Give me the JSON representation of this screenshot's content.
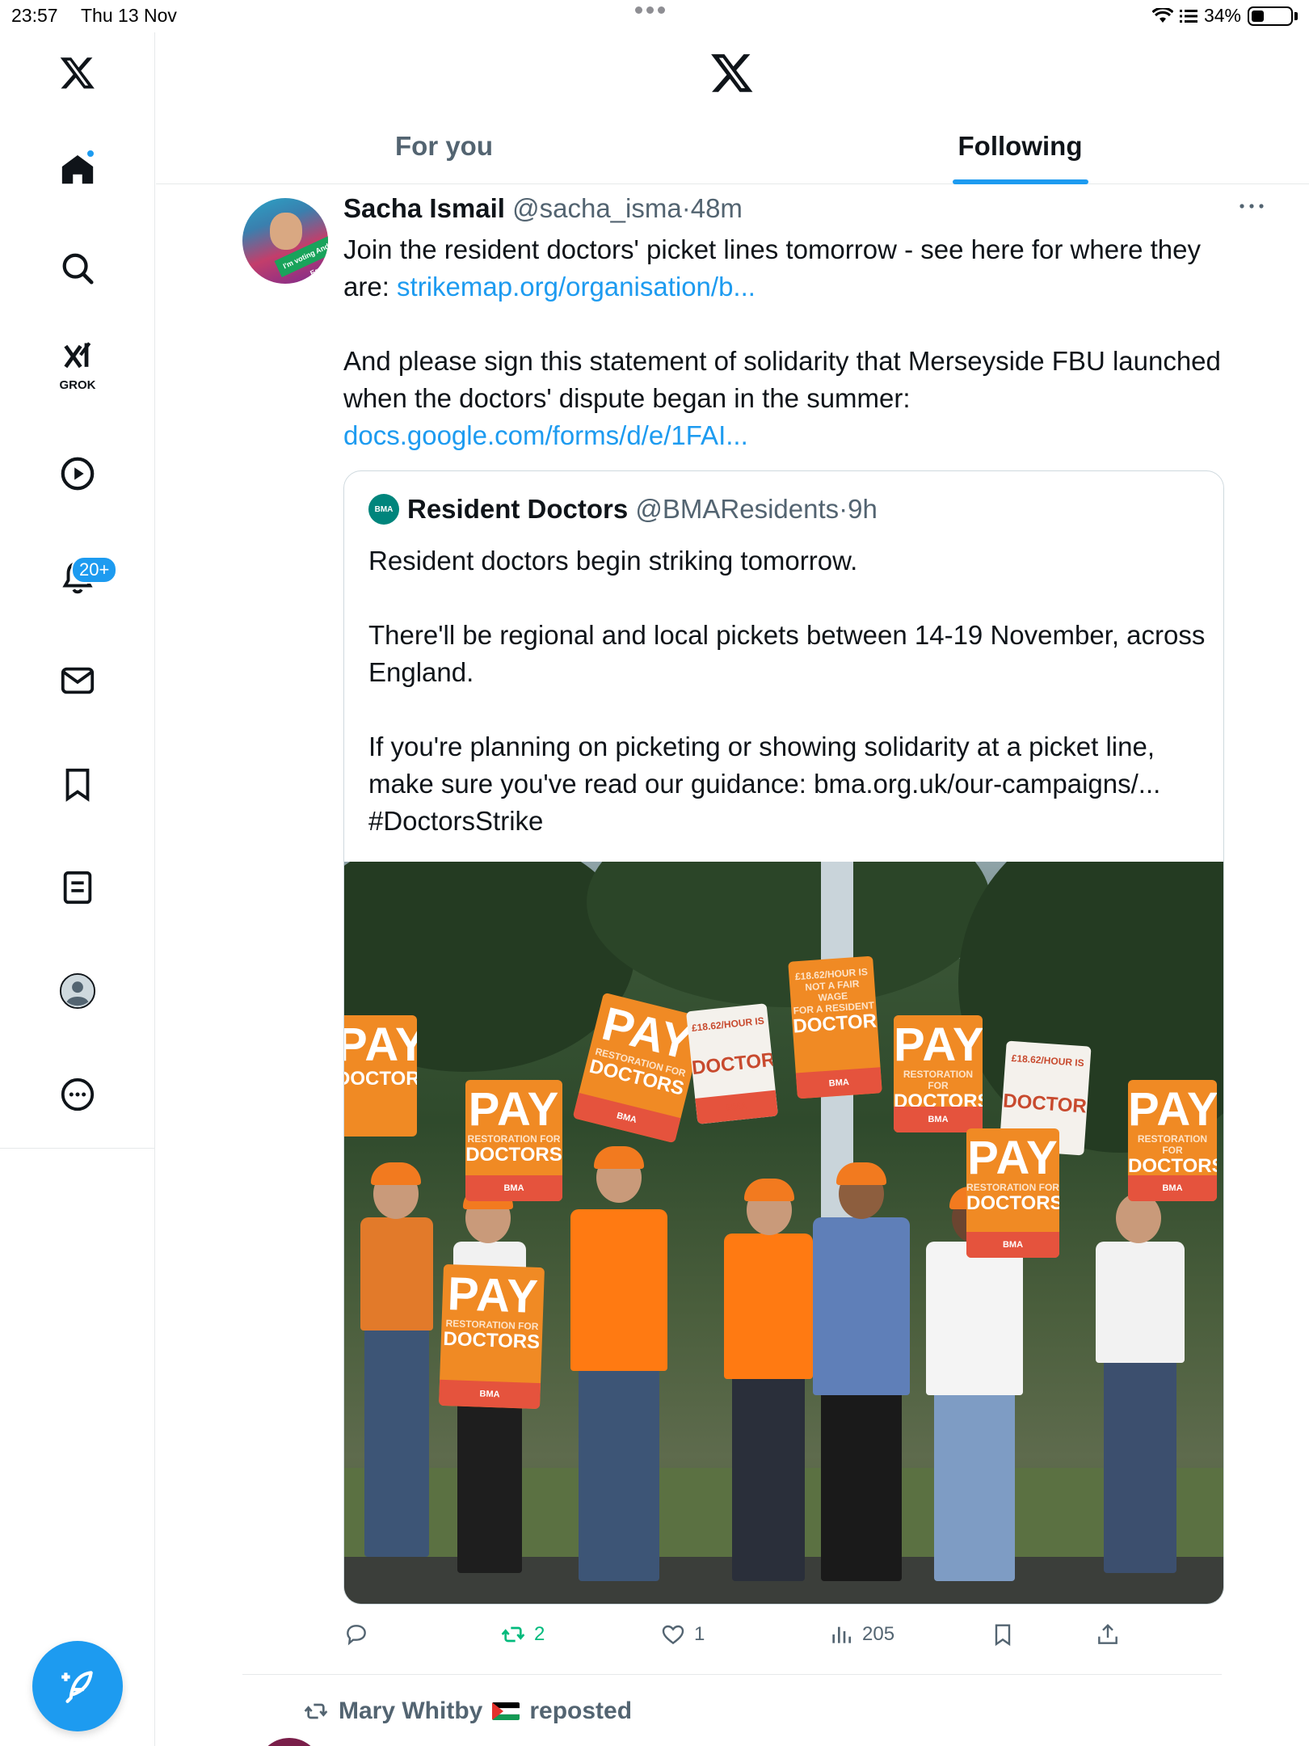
{
  "status_bar": {
    "time": "23:57",
    "date": "Thu 13 Nov",
    "battery": "34%"
  },
  "sidebar": {
    "notifications_badge": "20+",
    "grok_label": "GROK",
    "icons": [
      "x-logo-icon",
      "home-icon",
      "search-icon",
      "grok-icon",
      "video-icon",
      "bell-icon",
      "mail-icon",
      "bookmark-icon",
      "lists-icon",
      "profile-icon",
      "more-circle-icon"
    ]
  },
  "header": {
    "tabs": [
      {
        "label": "For you",
        "active": false
      },
      {
        "label": "Following",
        "active": true
      }
    ]
  },
  "tweet": {
    "display_name": "Sacha Ismail",
    "handle": "@sacha_isma",
    "separator": "·",
    "time": "48m",
    "avatar_band_text": "I'm voting Andrea Egan",
    "text_line1": "Join the resident doctors' picket lines tomorrow - see here for where they are: ",
    "link1": "strikemap.org/organisation/b...",
    "text_line2": "And please sign this statement of solidarity that Merseyside FBU launched when the doctors' dispute began in the summer:",
    "link2": "docs.google.com/forms/d/e/1FAI...",
    "quote": {
      "avatar_text": "BMA",
      "display_name": "Resident Doctors",
      "handle": "@BMAResidents",
      "separator": "·",
      "time": "9h",
      "para1": "Resident doctors begin striking tomorrow.",
      "para2": "There'll be regional and local pickets between 14-19 November, across England.",
      "para3": "If you're planning on picketing or showing solidarity at a picket line, make sure you've read our guidance: bma.org.uk/our-campaigns/...",
      "hashtag": "#DoctorsStrike",
      "image_signs": {
        "pay": "PAY",
        "restoration": "RESTORATION FOR",
        "doctors": "DOCTORS",
        "wage_line1": "£18.62/HOUR IS",
        "wage_line2": "NOT A FAIR WAGE",
        "wage_line3": "FOR A RESIDENT",
        "doctor": "DOCTOR",
        "bma": "BMA"
      }
    },
    "actions": {
      "reply_count": "",
      "retweet_count": "2",
      "like_count": "1",
      "views_count": "205"
    }
  },
  "next_item": {
    "reposter": "Mary Whitby",
    "reposted_label": "reposted"
  },
  "colors": {
    "accent": "#1d9bf0",
    "retweet_green": "#00ba7c",
    "muted": "#536471"
  }
}
